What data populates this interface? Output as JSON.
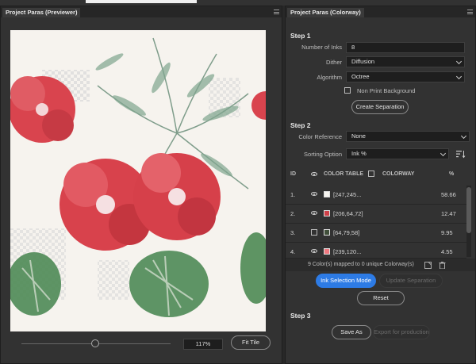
{
  "left_panel": {
    "title": "Project Paras (Previewer)",
    "zoom": "117%",
    "fit_tile_label": "Fit Tile"
  },
  "right_panel": {
    "title": "Project Paras (Colorway)",
    "step1": {
      "heading": "Step 1",
      "inks_label": "Number of Inks",
      "inks_value": "8",
      "dither_label": "Dither",
      "dither_value": "Diffusion",
      "algorithm_label": "Algorithm",
      "algorithm_value": "Octree",
      "nonprint_label": "Non Print Background",
      "create_label": "Create Separation"
    },
    "step2": {
      "heading": "Step 2",
      "color_ref_label": "Color Reference",
      "color_ref_value": "None",
      "sorting_label": "Sorting Option",
      "sorting_value": "Ink %",
      "table": {
        "col_id": "ID",
        "col_color_table": "COLOR TABLE",
        "col_colorway": "COLORWAY",
        "col_pct": "%",
        "rows": [
          {
            "id": "1.",
            "value": "[247,245...",
            "pct": "58.66",
            "color": "#f7f5f0"
          },
          {
            "id": "2.",
            "value": "[206,64,72]",
            "pct": "12.47",
            "color": "#ce4048"
          },
          {
            "id": "3.",
            "value": "[64,79,58]",
            "pct": "9.95",
            "color": "#404f3a"
          },
          {
            "id": "4.",
            "value": "[239,120...",
            "pct": "4.55",
            "color": "#ef7880"
          }
        ]
      },
      "summary": "9 Color(s) mapped to 0 unique Colorway(s)",
      "ink_mode_label": "Ink Selection Mode",
      "update_label": "Update Separation",
      "reset_label": "Reset"
    },
    "step3": {
      "heading": "Step 3",
      "save_as_label": "Save As",
      "export_label": "Export for production"
    }
  }
}
